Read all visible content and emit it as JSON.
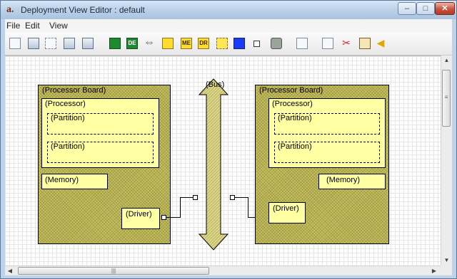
{
  "window": {
    "title": "Deployment View Editor : default",
    "controls": {
      "minimize": "–",
      "maximize": "□",
      "close": "✕"
    }
  },
  "menu": [
    "File",
    "Edit",
    "View"
  ],
  "toolbar": {
    "icons": [
      "new-document-icon",
      "open-folder-icon",
      "refresh-icon",
      "save-icon",
      "save-as-icon",
      "processor-board-icon",
      "driver-entity-icon",
      "bus-icon",
      "memory-icon",
      "memory-element-icon",
      "driver-icon",
      "partition-icon",
      "processor-icon",
      "port-icon",
      "database-icon",
      "zoom-icon",
      "copy-icon",
      "cut-icon",
      "paste-icon",
      "arrow-icon"
    ],
    "labels": {
      "de": "DE",
      "me": "ME",
      "dr": "DR"
    },
    "glyphs": {
      "bus": "⇔",
      "scissors": "✂",
      "edge": "◀"
    }
  },
  "diagram": {
    "left_board": {
      "label": "(Processor Board)",
      "processor": "(Processor)",
      "partitions": [
        "(Partition)",
        "(Partition)"
      ],
      "memory": "(Memory)",
      "driver": "(Driver)"
    },
    "bus": {
      "label": "(Bus)"
    },
    "right_board": {
      "label": "(Processor Board)",
      "processor": "(Processor)",
      "partitions": [
        "(Partition)",
        "(Partition)"
      ],
      "memory": "(Memory)",
      "driver": "(Driver)"
    }
  },
  "scrollbars": {
    "up": "▲",
    "down": "▼",
    "left": "◀",
    "right": "▶",
    "grip_v": "≡",
    "grip_h": "|||"
  },
  "colors": {
    "board_fill": "#c5c063",
    "component_fill": "#ffffa4",
    "bus_fill": "#dcd68a"
  }
}
